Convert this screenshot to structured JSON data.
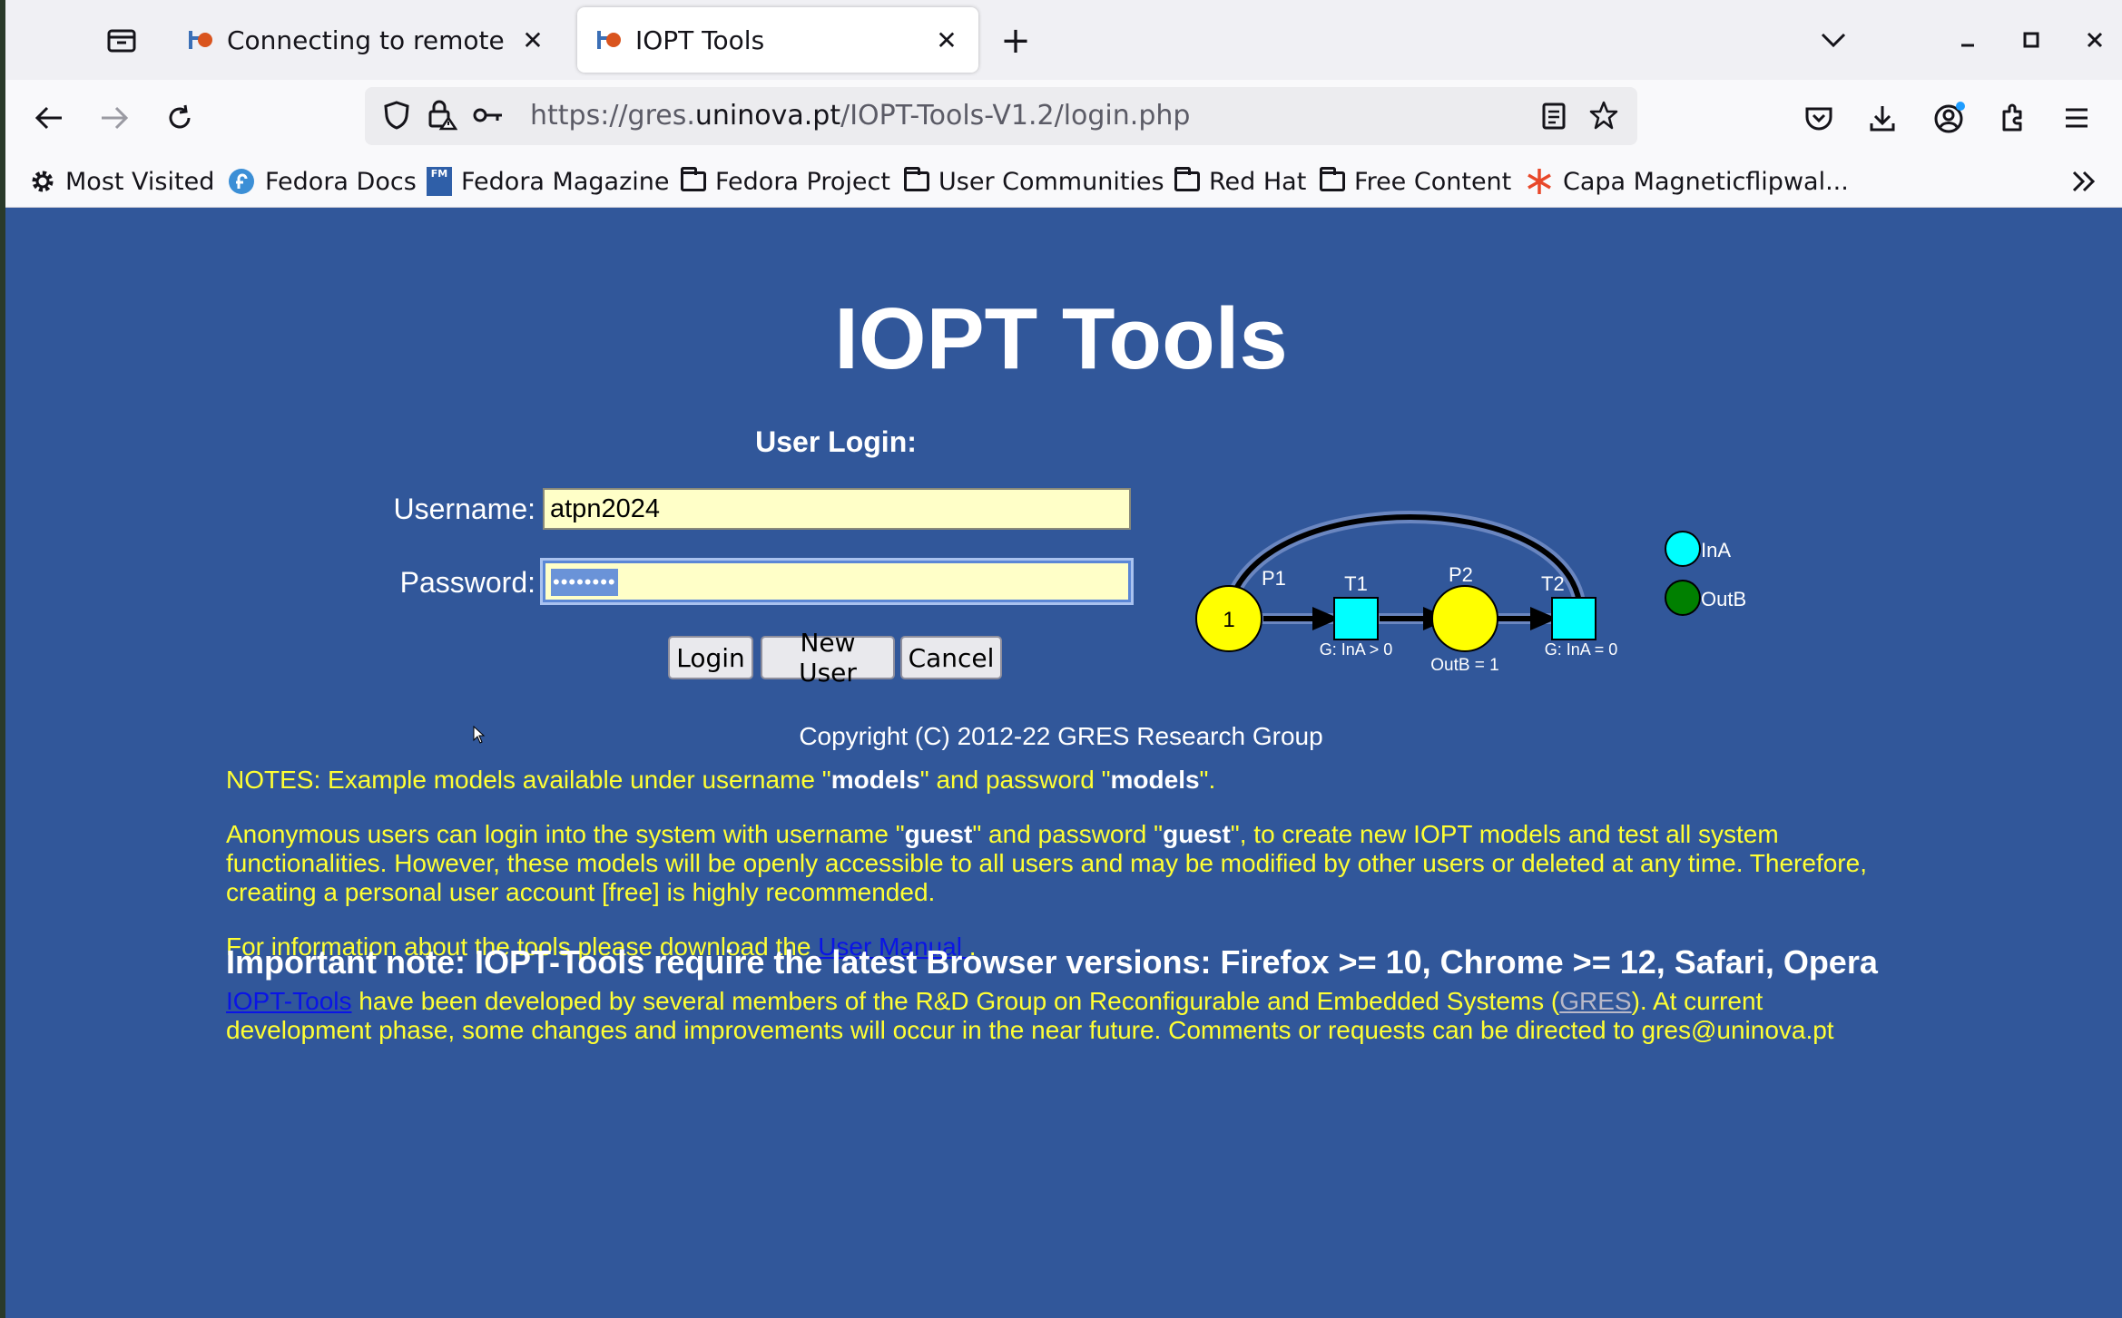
{
  "browser": {
    "tabs": [
      {
        "title": "Connecting to remote hard",
        "active": false
      },
      {
        "title": "IOPT Tools",
        "active": true
      }
    ],
    "url_prefix": "https://gres.",
    "url_domain": "uninova.pt",
    "url_path": "/IOPT-Tools-V1.2/login.php",
    "bookmarks": [
      {
        "label": "Most Visited",
        "icon": "gear-icon"
      },
      {
        "label": "Fedora Docs",
        "icon": "fedora-icon"
      },
      {
        "label": "Fedora Magazine",
        "icon": "fm-icon"
      },
      {
        "label": "Fedora Project",
        "icon": "folder-icon"
      },
      {
        "label": "User Communities",
        "icon": "folder-icon"
      },
      {
        "label": "Red Hat",
        "icon": "folder-icon"
      },
      {
        "label": "Free Content",
        "icon": "folder-icon"
      },
      {
        "label": "Capa Magneticflipwal...",
        "icon": "asterisk-icon"
      }
    ],
    "fm_badge": "FM"
  },
  "page": {
    "title": "IOPT Tools",
    "login_heading": "User Login:",
    "username_label": "Username:",
    "username_value": "atpn2024",
    "password_label": "Password:",
    "password_mask": "••••••••",
    "buttons": {
      "login": "Login",
      "new_user": "New User",
      "cancel": "Cancel"
    },
    "copyright": "Copyright (C) 2012-22 GRES Research Group",
    "notes": {
      "n1_a": "NOTES: Example models available under username \"",
      "n1_b": "models",
      "n1_c": "\" and password \"",
      "n1_d": "models",
      "n1_e": "\".",
      "n2_a": "Anonymous users can login into the system with username \"",
      "n2_b": "guest",
      "n2_c": "\" and password \"",
      "n2_d": "guest",
      "n2_e": "\", to create new IOPT models and test all system functionalities. However, these models will be openly accessible to all users and may be modified by other users or deleted at any time. Therefore, creating a personal user account [free] is highly recommended.",
      "n3_a": "For information about the tools please download the ",
      "n3_link": "User Manual ",
      "n3_b": ".",
      "n4_link": "IOPT-Tools",
      "n4_a": " have been developed by several members of the R&D Group on Reconfigurable and Embedded Systems (",
      "n4_gres": "GRES",
      "n4_b": "). At current development phase, some changes and improvements will occur in the near future. Comments or requests can be directed to gres@uninova.pt"
    },
    "important": "Important note: IOPT-Tools require the latest Browser versions: Firefox >= 10, Chrome >= 12, Safari, Opera"
  },
  "diagram": {
    "p1_label": "P1",
    "p1_tokens": "1",
    "t1_label": "T1",
    "t1_guard": "G: InA > 0",
    "p2_label": "P2",
    "p2_action": "OutB = 1",
    "t2_label": "T2",
    "t2_guard": "G: InA = 0",
    "input_label": "InA",
    "output_label": "OutB",
    "colors": {
      "place": "#ffff00",
      "transition": "#00ffff",
      "input": "#00ffff",
      "output": "#008000"
    }
  }
}
